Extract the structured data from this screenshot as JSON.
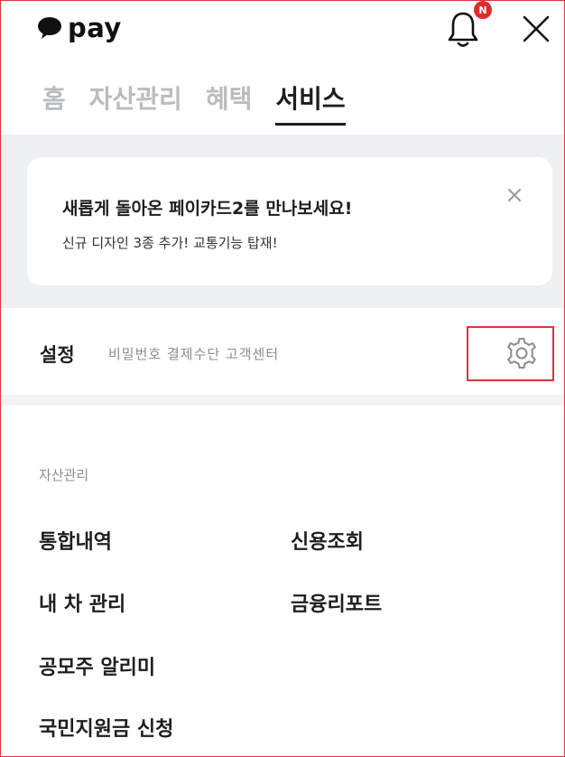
{
  "header": {
    "logo_text": "pay",
    "notification_badge": "N",
    "tabs": [
      {
        "label": "홈",
        "active": false
      },
      {
        "label": "자산관리",
        "active": false
      },
      {
        "label": "혜택",
        "active": false
      },
      {
        "label": "서비스",
        "active": true
      }
    ]
  },
  "banner": {
    "title": "새롭게 돌아온 페이카드2를 만나보세요!",
    "subtitle": "신규 디자인 3종 추가! 교통기능 탑재!"
  },
  "settings": {
    "title": "설정",
    "subtitle": "비밀번호 결제수단 고객센터"
  },
  "assets": {
    "section_label": "자산관리",
    "items": [
      {
        "label": "통합내역"
      },
      {
        "label": "신용조회"
      },
      {
        "label": "내 차 관리"
      },
      {
        "label": "금융리포트"
      },
      {
        "label": "공모주 알리미"
      },
      {
        "label": "국민지원금 신청"
      }
    ]
  },
  "colors": {
    "accent_red": "#d9353a",
    "badge_red": "#e22b2b",
    "gray_bg": "#eff0f2",
    "inactive_tab": "#b9bcc0"
  }
}
